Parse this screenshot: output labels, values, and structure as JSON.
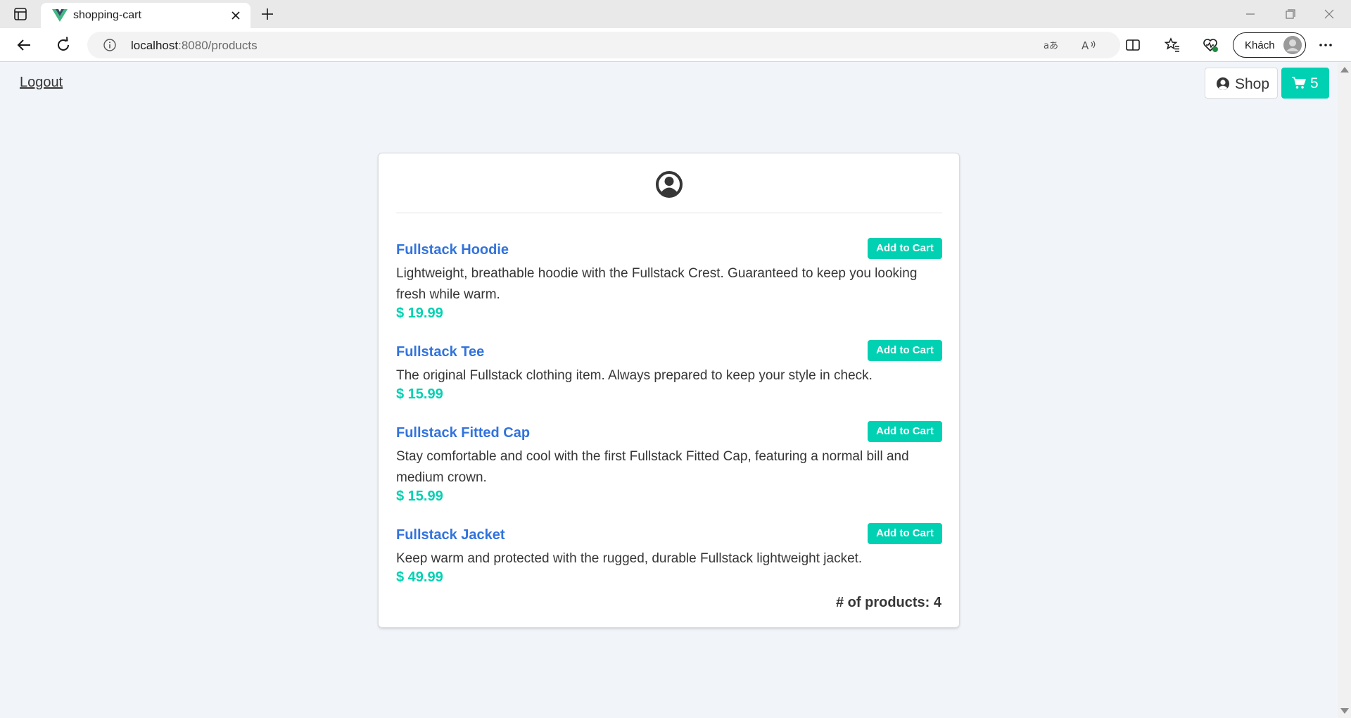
{
  "browser": {
    "tab_title": "shopping-cart",
    "url_host": "localhost",
    "url_path": ":8080/products",
    "profile_name": "Khách"
  },
  "header": {
    "logout_label": "Logout",
    "shop_label": "Shop",
    "cart_count": "5"
  },
  "products": [
    {
      "name": "Fullstack Hoodie",
      "description": "Lightweight, breathable hoodie with the Fullstack Crest. Guaranteed to keep you looking fresh while warm.",
      "price": "$ 19.99",
      "button_label": "Add to Cart"
    },
    {
      "name": "Fullstack Tee",
      "description": "The original Fullstack clothing item. Always prepared to keep your style in check.",
      "price": "$ 15.99",
      "button_label": "Add to Cart"
    },
    {
      "name": "Fullstack Fitted Cap",
      "description": "Stay comfortable and cool with the first Fullstack Fitted Cap, featuring a normal bill and medium crown.",
      "price": "$ 15.99",
      "button_label": "Add to Cart"
    },
    {
      "name": "Fullstack Jacket",
      "description": "Keep warm and protected with the rugged, durable Fullstack lightweight jacket.",
      "price": "$ 49.99",
      "button_label": "Add to Cart"
    }
  ],
  "footer": {
    "product_count_label": "# of products: 4"
  },
  "colors": {
    "accent": "#00d1b2",
    "link": "#3273dc",
    "text": "#363636",
    "background": "#f1f4f8"
  },
  "icons": {
    "card_header": "user-circle-icon",
    "shop": "user-circle-icon",
    "cart": "shopping-cart-icon"
  }
}
